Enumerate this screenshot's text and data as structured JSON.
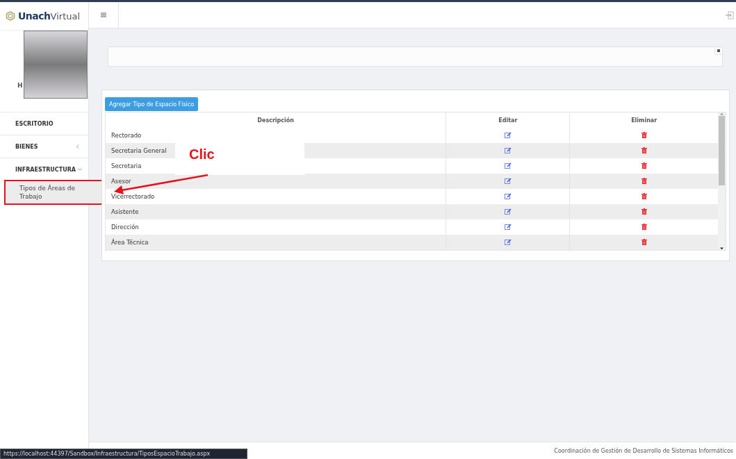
{
  "brand": {
    "bold": "Unach",
    "light": "Virtual"
  },
  "user": {
    "name_visible": "H"
  },
  "sidebar": {
    "items": [
      {
        "label": "ESCRITORIO",
        "kind": "link"
      },
      {
        "label": "BIENES",
        "kind": "group",
        "expanded": false
      },
      {
        "label": "INFRAESTRUCTURA",
        "kind": "group",
        "expanded": true,
        "children": [
          {
            "label": "Tipos de Áreas de Trabajo",
            "selected": true
          }
        ]
      }
    ]
  },
  "add_button": "Agregar Tipo de Espacio Físico",
  "table": {
    "columns": [
      "Descripción",
      "Editar",
      "Eliminar"
    ],
    "rows": [
      {
        "description": "Rectorado"
      },
      {
        "description": "Secretaria General"
      },
      {
        "description": "Secretaria"
      },
      {
        "description": "Asesor"
      },
      {
        "description": "Vicerrectorado"
      },
      {
        "description": "Asistente"
      },
      {
        "description": "Dirección"
      },
      {
        "description": "Área Técnica"
      }
    ]
  },
  "annotation": {
    "text": "Clic"
  },
  "footer": "Coordinación de Gestión de Desarrollo de Sistemas Informáticos",
  "status_url": "https://localhost:44397/Sandbox/Infraestructura/TiposEspacioTrabajo.aspx"
}
